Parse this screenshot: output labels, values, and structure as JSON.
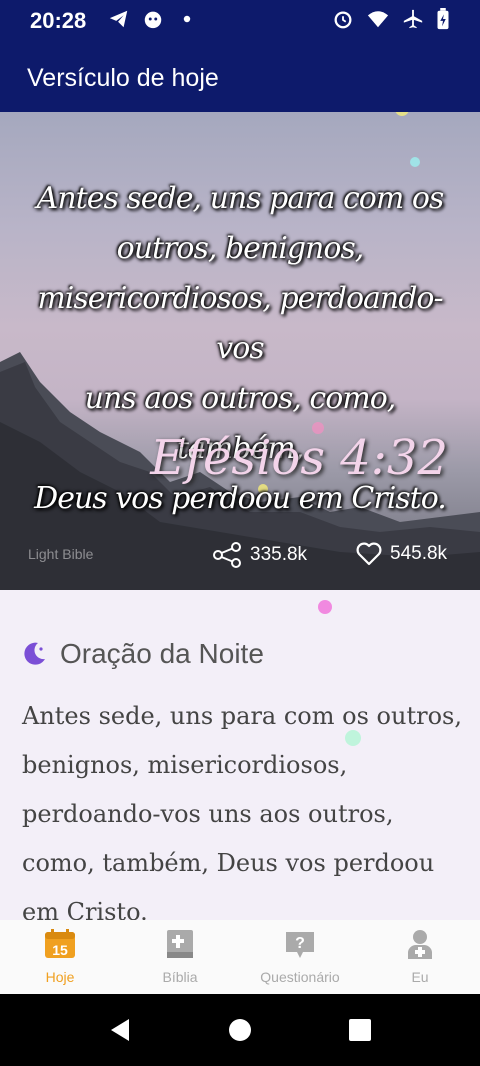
{
  "status": {
    "time": "20:28",
    "left_icons": [
      "telegram-icon",
      "app-icon",
      "dot-icon"
    ],
    "right_icons": [
      "alarm-icon",
      "wifi-icon",
      "airplane-icon",
      "battery-icon"
    ]
  },
  "appbar": {
    "title": "Versículo de hoje"
  },
  "verse": {
    "lines": [
      "Antes sede, uns para com os",
      "outros, benignos,",
      "misericordiosos, perdoando-vos",
      "uns aos outros, como, também,",
      "Deus vos perdoou em Cristo."
    ],
    "reference": "Efésios 4:32",
    "watermark": "Light Bible",
    "share_count": "335.8k",
    "like_count": "545.8k"
  },
  "prayer": {
    "title": "Oração da Noite",
    "icon": "moon-icon",
    "text": "Antes sede, uns para com os outros, benignos, misericordiosos, perdoando-vos uns aos outros, como, também, Deus vos perdoou em Cristo."
  },
  "nav": {
    "items": [
      {
        "label": "Hoje",
        "icon": "calendar-icon",
        "active": true
      },
      {
        "label": "Bíblia",
        "icon": "bible-icon",
        "active": false
      },
      {
        "label": "Questionário",
        "icon": "quiz-icon",
        "active": false
      },
      {
        "label": "Eu",
        "icon": "profile-icon",
        "active": false
      }
    ]
  },
  "colors": {
    "primary": "#0d1a6b",
    "accent": "#f0a020",
    "moon": "#7b4fd6"
  }
}
